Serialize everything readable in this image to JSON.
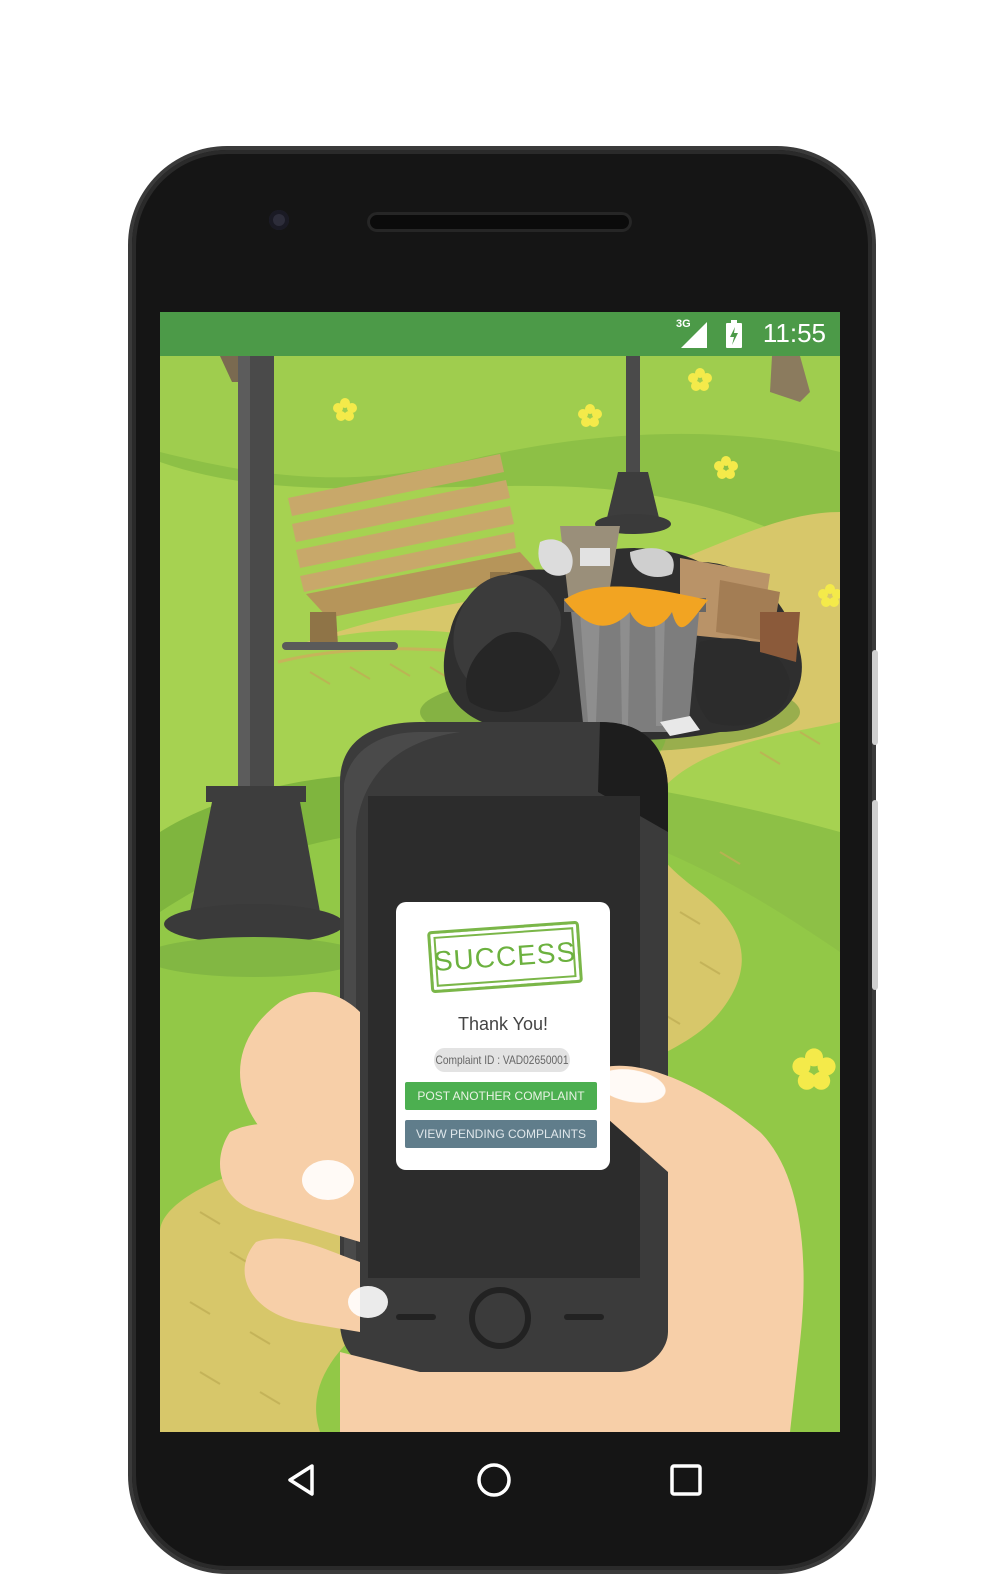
{
  "status_bar": {
    "network": "3G",
    "time": "11:55"
  },
  "dialog": {
    "stamp": "SUCCESS",
    "message": "Thank You!",
    "complaint_id": "Complaint ID : VAD02650001",
    "primary_button": "POST ANOTHER COMPLAINT",
    "secondary_button": "VIEW PENDING COMPLAINTS"
  },
  "nav": {
    "back": "back-icon",
    "home": "home-icon",
    "recents": "recents-icon"
  },
  "colors": {
    "status_bar": "#4c9a48",
    "grass": "#8fc24a",
    "primary_button": "#4caf50",
    "secondary_button": "#607d8b",
    "stamp": "#6cb13f"
  }
}
